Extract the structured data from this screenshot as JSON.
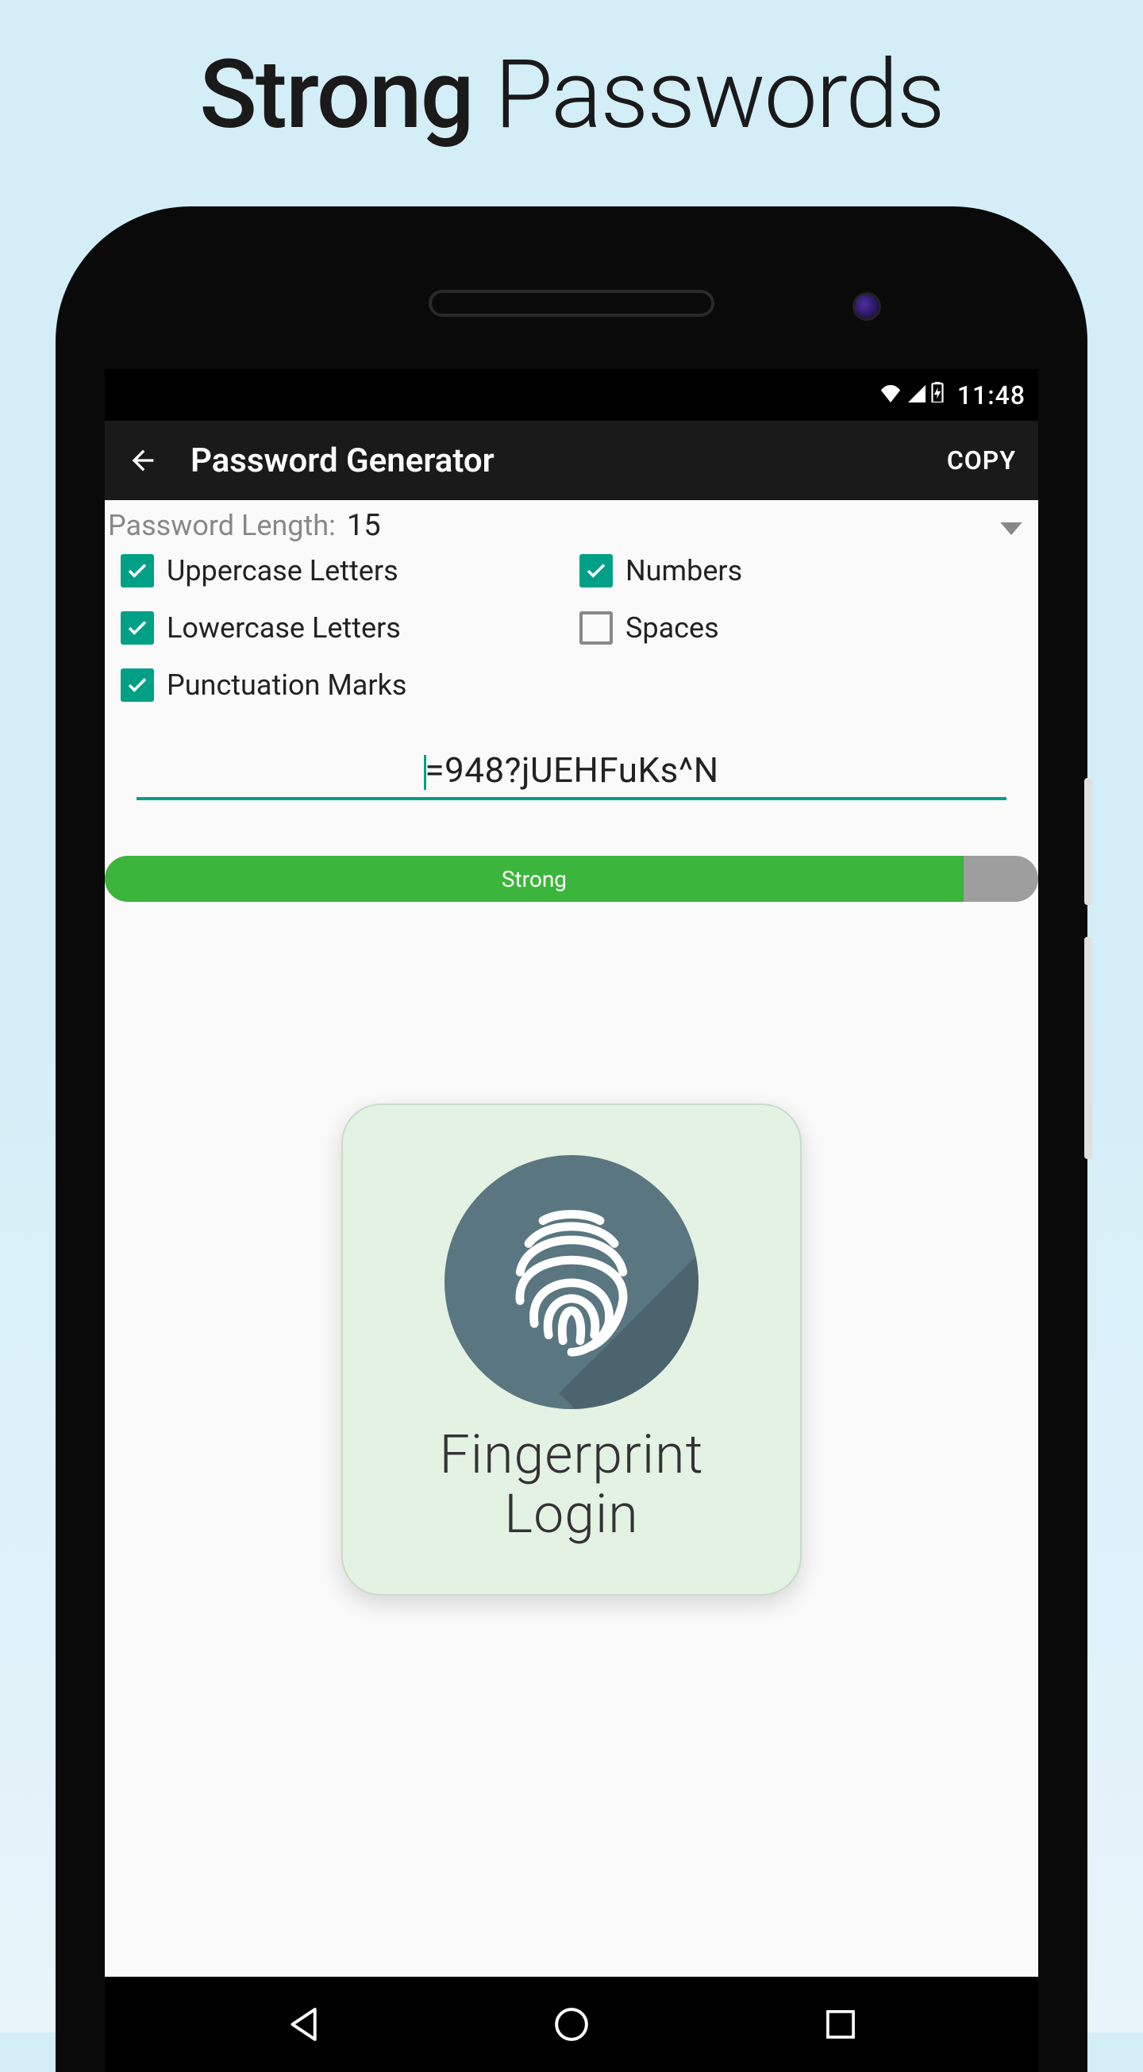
{
  "promo": {
    "title_bold": "Strong",
    "title_light": "Passwords"
  },
  "statusbar": {
    "time": "11:48"
  },
  "appbar": {
    "title": "Password Generator",
    "copy": "COPY"
  },
  "length": {
    "label": "Password Length:",
    "value": "15"
  },
  "options": {
    "uppercase": {
      "label": "Uppercase Letters",
      "checked": true
    },
    "numbers": {
      "label": "Numbers",
      "checked": true
    },
    "lowercase": {
      "label": "Lowercase Letters",
      "checked": true
    },
    "spaces": {
      "label": "Spaces",
      "checked": false
    },
    "punct": {
      "label": "Punctuation Marks",
      "checked": true
    }
  },
  "password": {
    "value": "=948?jUEHFuKs^N"
  },
  "strength": {
    "label": "Strong",
    "percent": 92
  },
  "fingerprint": {
    "line1": "Fingerprint",
    "line2": "Login"
  },
  "colors": {
    "accent": "#00a087",
    "strength_green": "#3cb53c",
    "fp_bg": "#e4f2e3",
    "fp_circle": "#5a7680"
  }
}
